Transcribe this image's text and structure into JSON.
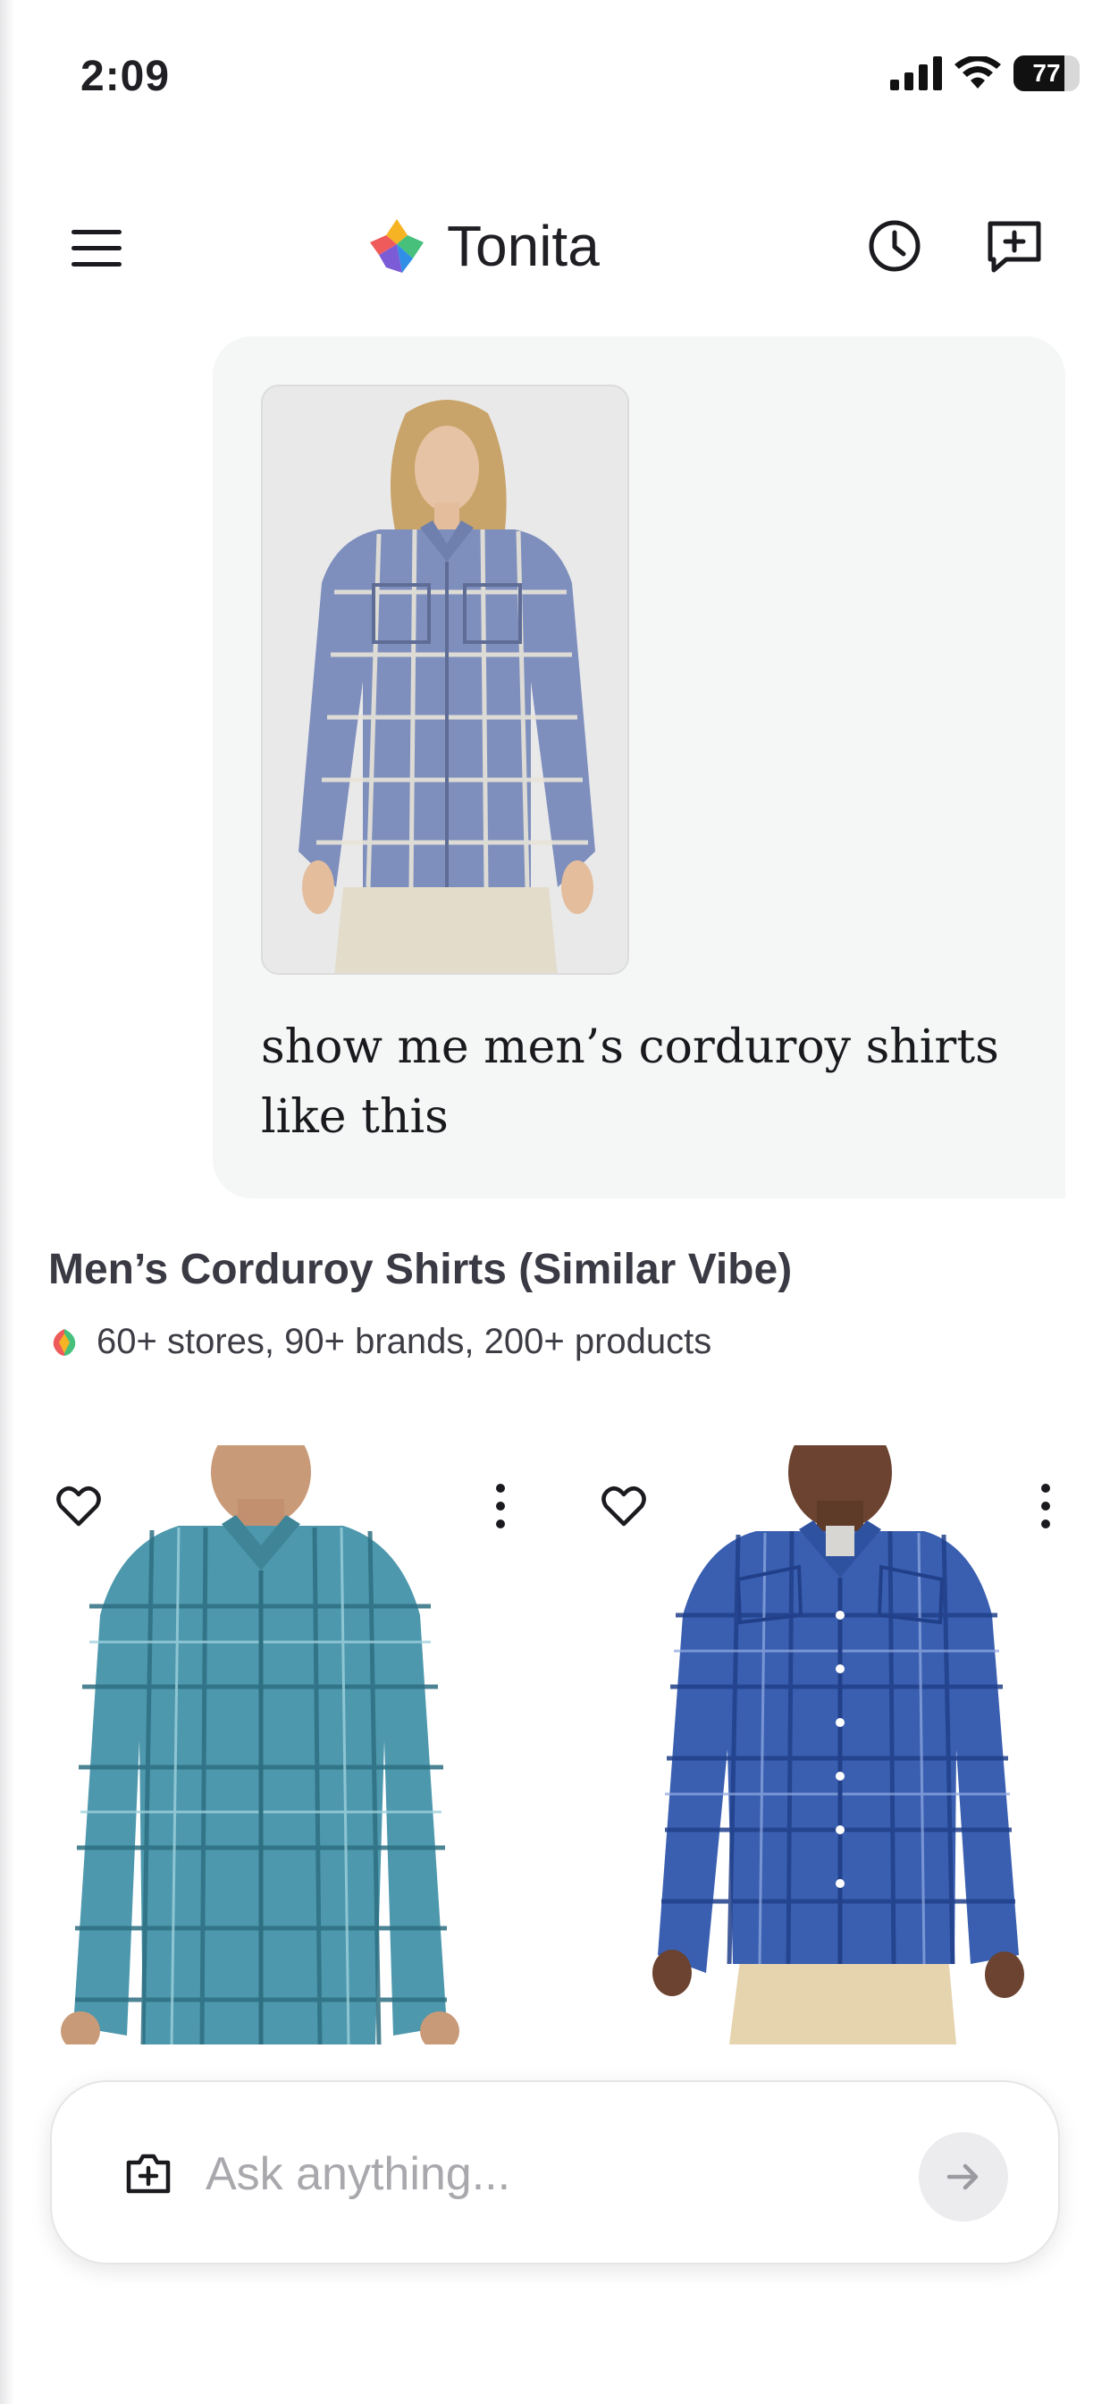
{
  "status_bar": {
    "time": "2:09",
    "battery": "77",
    "battery_level": 0.77
  },
  "header": {
    "app_title": "Tonita",
    "logo_icon": "tonita-logo-icon",
    "menu_icon": "menu-icon",
    "history_icon": "history-clock-icon",
    "new_chat_icon": "new-chat-icon"
  },
  "conversation": {
    "user_message": {
      "image": "woman in blue plaid corduroy shirt",
      "text": "show me men’s corduroy shirts like this"
    },
    "response": {
      "title": "Men’s Corduroy Shirts (Similar Vibe)",
      "summary": "60+ stores, 90+ brands, 200+ products"
    },
    "products": [
      {
        "image": "man in teal plaid corduroy shirt",
        "favorite_icon": "heart-icon",
        "menu_icon": "more-vertical-icon"
      },
      {
        "image": "man in blue plaid western shirt",
        "favorite_icon": "heart-icon",
        "menu_icon": "more-vertical-icon"
      }
    ]
  },
  "composer": {
    "placeholder": "Ask anything...",
    "attach_icon": "add-photo-icon",
    "send_icon": "arrow-right-icon"
  },
  "colors": {
    "bubble_bg": "#f5f6f6",
    "text": "#1f1f24",
    "placeholder": "#a8a8ad",
    "send_bg": "#ececee"
  }
}
